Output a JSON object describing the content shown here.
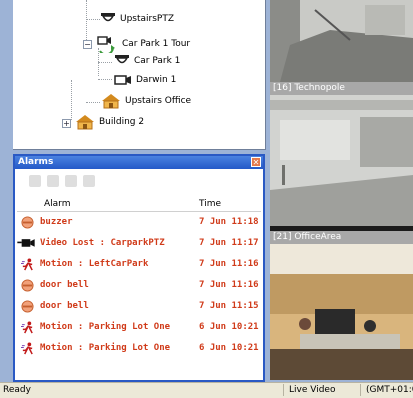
{
  "tree": {
    "items": [
      {
        "label": "UpstairsPTZ",
        "icon": "ptz-camera-icon"
      },
      {
        "label": "Car Park 1 Tour",
        "icon": "camera-tour-icon"
      },
      {
        "label": "Car Park 1",
        "icon": "dome-camera-icon"
      },
      {
        "label": "Darwin 1",
        "icon": "fixed-camera-icon"
      },
      {
        "label": "Upstairs Office",
        "icon": "building-icon"
      },
      {
        "label": "Building 2",
        "icon": "building-icon"
      }
    ]
  },
  "alarms": {
    "title": "Alarms",
    "columns": {
      "alarm": "Alarm",
      "time": "Time"
    },
    "rows": [
      {
        "icon": "bell-icon",
        "text": "buzzer",
        "time": "7 Jun 11:18"
      },
      {
        "icon": "video-lost-icon",
        "text": "Video Lost : CarparkPTZ",
        "time": "7 Jun 11:17"
      },
      {
        "icon": "motion-icon",
        "text": "Motion : LeftCarPark",
        "time": "7 Jun 11:16"
      },
      {
        "icon": "bell-icon",
        "text": "door bell",
        "time": "7 Jun 11:16"
      },
      {
        "icon": "bell-icon",
        "text": "door bell",
        "time": "7 Jun 11:15"
      },
      {
        "icon": "motion-icon",
        "text": "Motion : Parking Lot One",
        "time": "6 Jun 10:21"
      },
      {
        "icon": "motion-icon",
        "text": "Motion : Parking Lot One",
        "time": "6 Jun 10:21"
      }
    ],
    "text_color": "#d03b1a"
  },
  "video": {
    "tiles": [
      {
        "label": ""
      },
      {
        "label": "[16] Technopole"
      },
      {
        "label": "[21] OfficeArea"
      }
    ]
  },
  "status": {
    "ready": "Ready",
    "mode": "Live Video",
    "timezone": "(GMT+01:0"
  }
}
